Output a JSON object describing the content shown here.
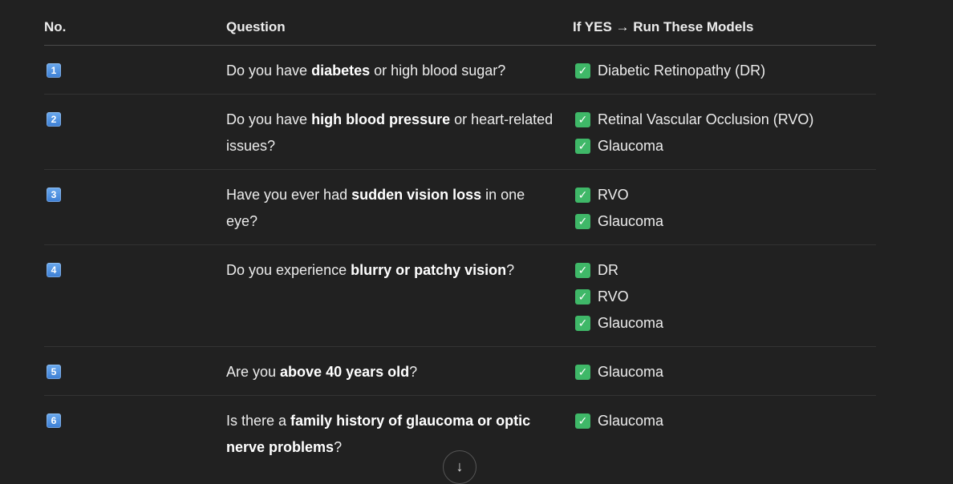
{
  "header": {
    "col_no": "No.",
    "col_question": "Question",
    "col_models": "If YES → Run These Models"
  },
  "rows": [
    {
      "no": "1",
      "question": {
        "pre": "Do you have ",
        "bold": "diabetes",
        "post": " or high blood sugar?"
      },
      "models": [
        "Diabetic Retinopathy (DR)"
      ]
    },
    {
      "no": "2",
      "question": {
        "pre": "Do you have ",
        "bold": "high blood pressure",
        "post": " or heart-related issues?"
      },
      "models": [
        "Retinal Vascular Occlusion (RVO)",
        "Glaucoma"
      ]
    },
    {
      "no": "3",
      "question": {
        "pre": "Have you ever had ",
        "bold": "sudden vision loss",
        "post": " in one eye?"
      },
      "models": [
        "RVO",
        "Glaucoma"
      ]
    },
    {
      "no": "4",
      "question": {
        "pre": "Do you experience ",
        "bold": "blurry or patchy vision",
        "post": "?"
      },
      "models": [
        "DR",
        "RVO",
        "Glaucoma"
      ]
    },
    {
      "no": "5",
      "question": {
        "pre": "Are you ",
        "bold": "above 40 years old",
        "post": "?"
      },
      "models": [
        "Glaucoma"
      ]
    },
    {
      "no": "6",
      "question": {
        "pre": "Is there a ",
        "bold": "family history of glaucoma or optic nerve problems",
        "post": "?"
      },
      "models": [
        "Glaucoma"
      ]
    }
  ],
  "icons": {
    "check": "check-mark-button-icon",
    "scroll": "arrow-down-icon"
  },
  "colors": {
    "background": "#212121",
    "text": "#ececec",
    "check_green": "#3fb868",
    "badge_blue": "#4a8fe0"
  }
}
